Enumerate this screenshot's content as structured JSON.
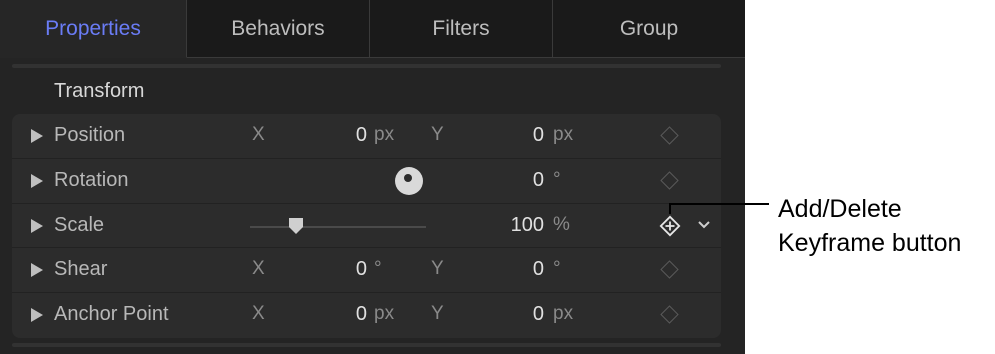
{
  "tabs": [
    {
      "label": "Properties",
      "active": true
    },
    {
      "label": "Behaviors",
      "active": false
    },
    {
      "label": "Filters",
      "active": false
    },
    {
      "label": "Group",
      "active": false
    }
  ],
  "section": {
    "title": "Transform"
  },
  "rows": [
    {
      "label": "Position",
      "x_axis": "X",
      "x_value": "0",
      "x_unit": "px",
      "y_axis": "Y",
      "y_value": "0",
      "y_unit": "px"
    },
    {
      "label": "Rotation",
      "value": "0",
      "unit": "°",
      "control": "dial"
    },
    {
      "label": "Scale",
      "value": "100",
      "unit": "%",
      "control": "slider"
    },
    {
      "label": "Shear",
      "x_axis": "X",
      "x_value": "0",
      "x_unit": "°",
      "y_axis": "Y",
      "y_value": "0",
      "y_unit": "°"
    },
    {
      "label": "Anchor Point",
      "x_axis": "X",
      "x_value": "0",
      "x_unit": "px",
      "y_axis": "Y",
      "y_value": "0",
      "y_unit": "px"
    }
  ],
  "callout": {
    "line1": "Add/Delete",
    "line2": "Keyframe button"
  },
  "colors": {
    "accent": "#6a7cf5",
    "panel_bg": "#242424",
    "row_bg": "#2c2c2c"
  },
  "icons": [
    "disclosure-triangle-icon",
    "keyframe-diamond-icon",
    "add-delete-keyframe-icon",
    "chevron-down-icon",
    "rotation-dial-icon",
    "slider-thumb-icon"
  ]
}
